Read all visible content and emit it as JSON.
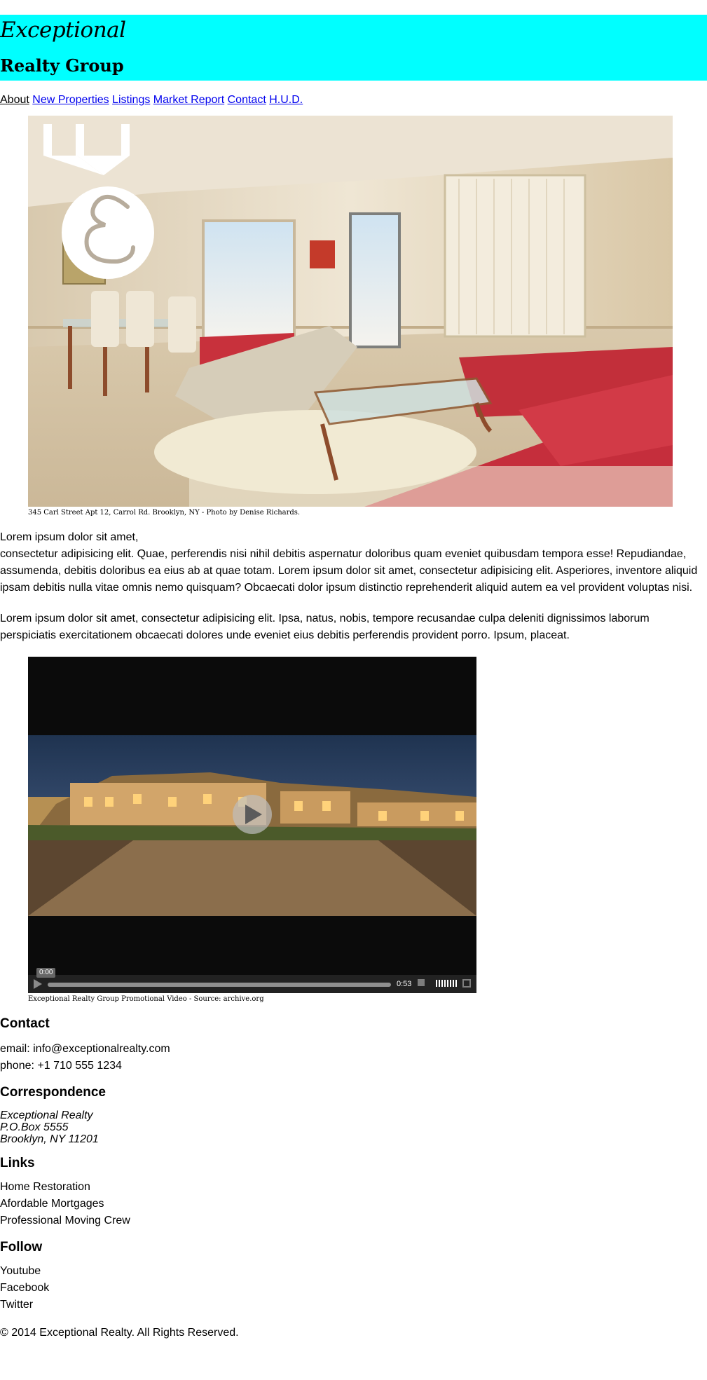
{
  "header": {
    "logo_script": "Exceptional",
    "logo_sub": "Realty Group"
  },
  "nav": [
    {
      "label": "About"
    },
    {
      "label": "New Properties"
    },
    {
      "label": "Listings"
    },
    {
      "label": "Market Report"
    },
    {
      "label": "Contact"
    },
    {
      "label": "H.U.D."
    }
  ],
  "hero": {
    "caption": "345 Carl Street Apt 12, Carrol Rd. Brooklyn, NY - Photo by Denise Richards."
  },
  "intro": {
    "p1_first": "Lorem ipsum dolor sit amet,",
    "p1_rest": "consectetur adipisicing elit. Quae, perferendis nisi nihil debitis aspernatur doloribus quam eveniet quibusdam tempora esse! Repudiandae, assumenda, debitis doloribus ea eius ab at quae totam. Lorem ipsum dolor sit amet, consectetur adipisicing elit. Asperiores, inventore aliquid ipsam debitis nulla vitae omnis nemo quisquam? Obcaecati dolor ipsum distinctio reprehenderit aliquid autem ea vel provident voluptas nisi.",
    "p2": "Lorem ipsum dolor sit amet, consectetur adipisicing elit. Ipsa, natus, nobis, tempore recusandae culpa deleniti dignissimos laborum perspiciatis exercitationem obcaecati dolores unde eveniet eius debitis perferendis provident porro. Ipsum, placeat."
  },
  "video": {
    "time_current": "0:00",
    "time_total": "0:53",
    "caption": "Exceptional Realty Group Promotional Video - Source: archive.org"
  },
  "contact": {
    "heading": "Contact",
    "email": "email: info@exceptionalrealty.com",
    "phone": "phone: +1 710 555 1234"
  },
  "correspondence": {
    "heading": "Correspondence",
    "lines": [
      "Exceptional Realty",
      "P.O.Box 5555",
      "Brooklyn, NY 11201"
    ]
  },
  "links": {
    "heading": "Links",
    "items": [
      "Home Restoration",
      "Afordable Mortgages",
      "Professional Moving Crew"
    ]
  },
  "follow": {
    "heading": "Follow",
    "items": [
      "Youtube",
      "Facebook",
      "Twitter"
    ]
  },
  "footer": {
    "copyright": "© 2014 Exceptional Realty. All Rights Reserved."
  },
  "colors": {
    "header_bg": "#00ffff",
    "link": "#0000ee",
    "video_bg": "#0b0b0b"
  }
}
